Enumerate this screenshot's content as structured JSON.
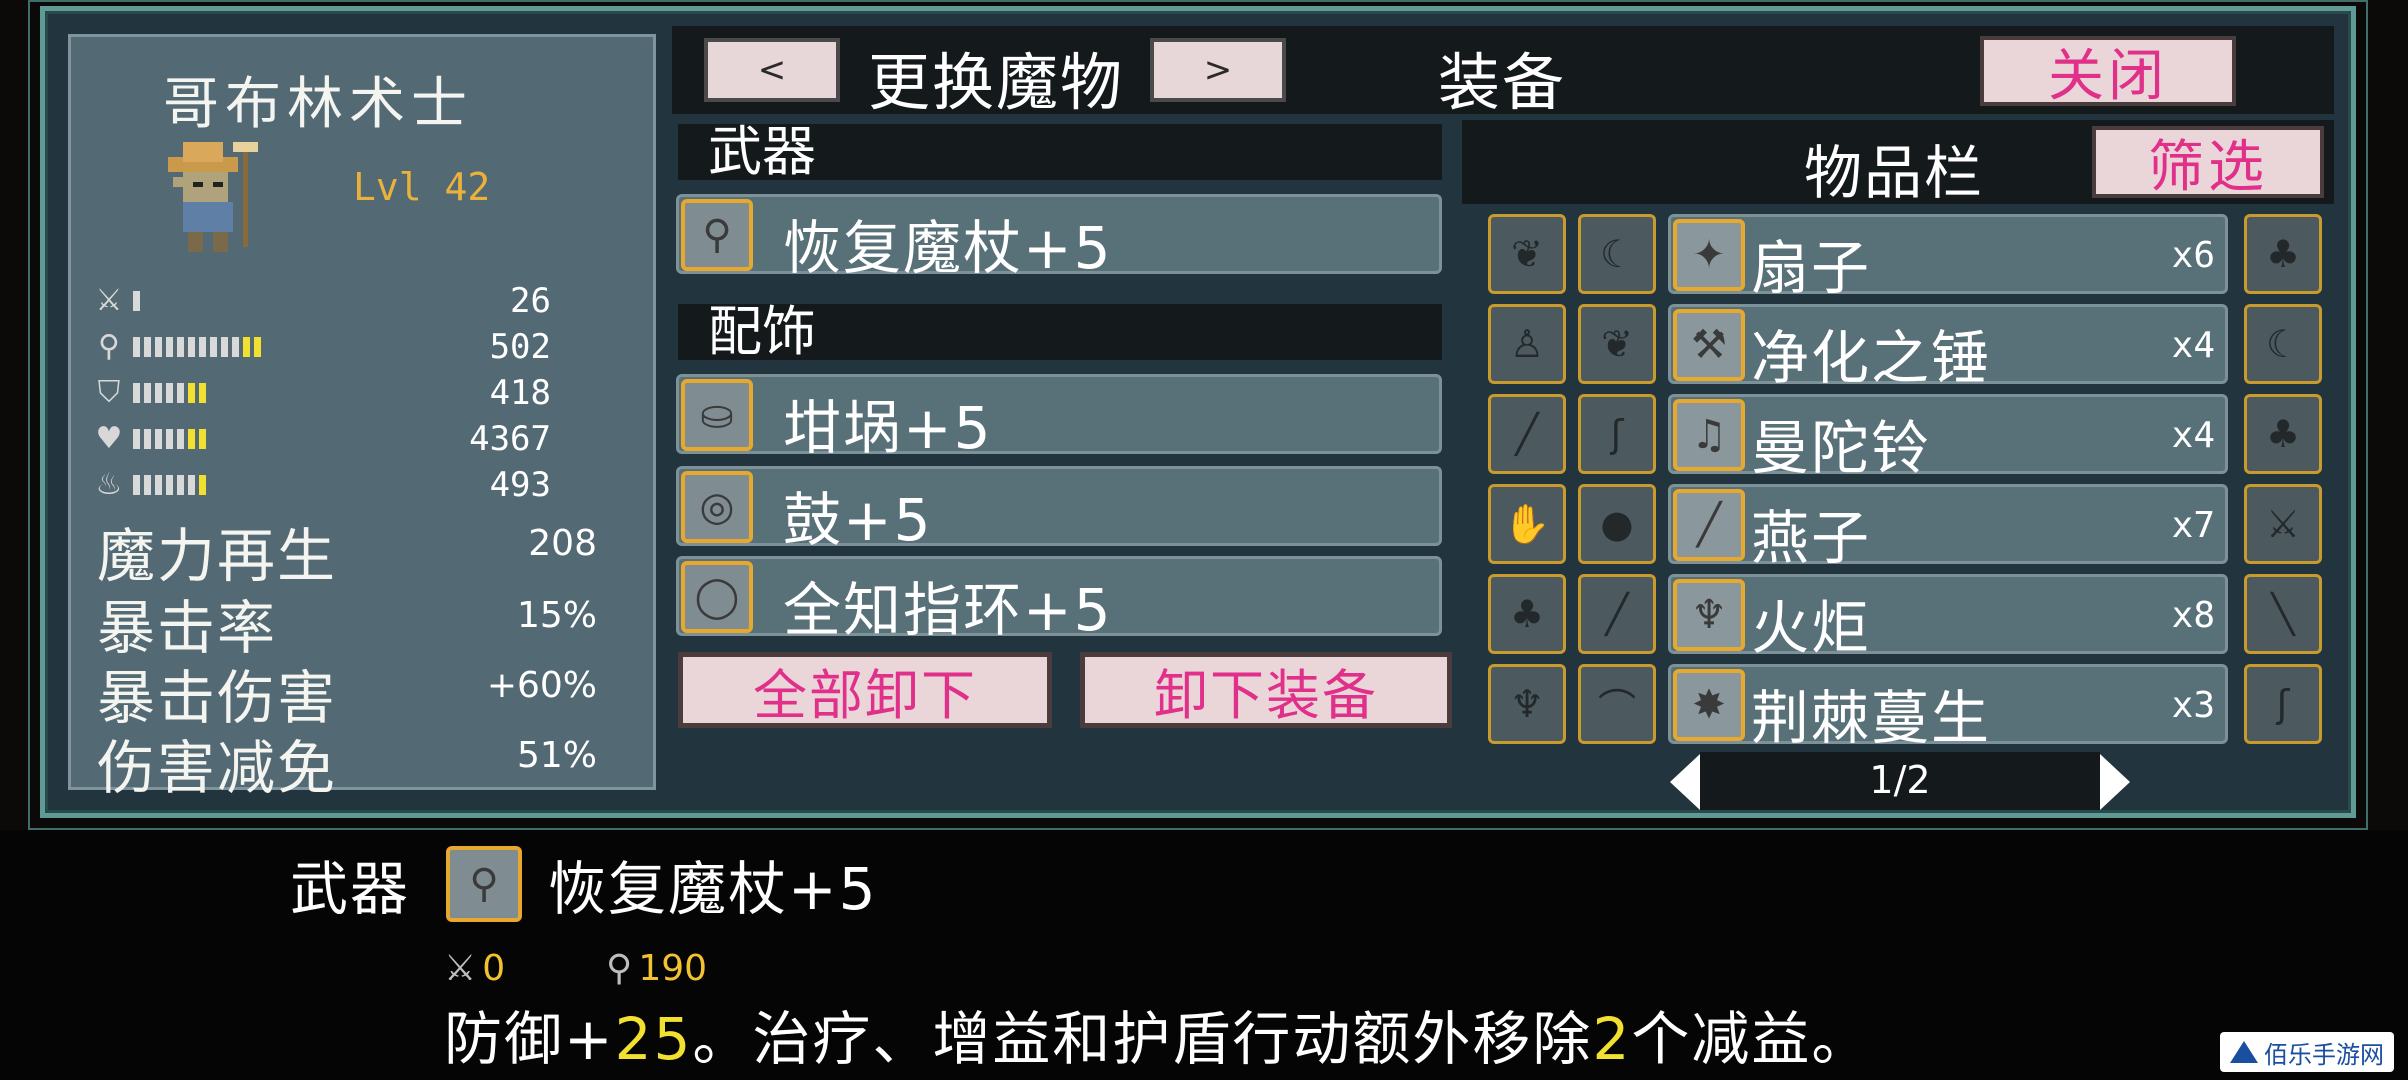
{
  "monster": {
    "name": "哥布林术士",
    "level": "Lvl 42",
    "stats": [
      {
        "icon": "sword-icon",
        "value": "26",
        "white": 1,
        "yellow": 0
      },
      {
        "icon": "staff-icon",
        "value": "502",
        "white": 10,
        "yellow": 2
      },
      {
        "icon": "shield-icon",
        "value": "418",
        "white": 5,
        "yellow": 2
      },
      {
        "icon": "heart-icon",
        "value": "4367",
        "white": 5,
        "yellow": 2
      },
      {
        "icon": "potion-icon",
        "value": "493",
        "white": 6,
        "yellow": 1
      }
    ],
    "labels": [
      {
        "label": "魔力再生",
        "value": "208"
      },
      {
        "label": "暴击率",
        "value": "15%"
      },
      {
        "label": "暴击伤害",
        "value": "+60%"
      },
      {
        "label": "伤害减免",
        "value": "51%"
      }
    ]
  },
  "topbar": {
    "prev": "<",
    "change_monster": "更换魔物",
    "next": ">",
    "equipment": "装备",
    "close": "关闭"
  },
  "weapon_section": {
    "title": "武器",
    "item": "恢复魔杖+5"
  },
  "accessory_section": {
    "title": "配饰",
    "items": [
      "坩埚+5",
      "鼓+5",
      "全知指环+5"
    ]
  },
  "actions": {
    "unequip_all": "全部卸下",
    "unequip": "卸下装备"
  },
  "inventory": {
    "title": "物品栏",
    "filter": "筛选",
    "rows": [
      {
        "name": "扇子",
        "count": "x6"
      },
      {
        "name": "净化之锤",
        "count": "x4"
      },
      {
        "name": "曼陀铃",
        "count": "x4"
      },
      {
        "name": "燕子",
        "count": "x7"
      },
      {
        "name": "火炬",
        "count": "x8"
      },
      {
        "name": "荆棘蔓生",
        "count": "x3"
      }
    ],
    "page": "1/2"
  },
  "details": {
    "category": "武器",
    "name": "恢复魔杖+5",
    "stat1": "0",
    "stat2": "190",
    "desc_part1": "防御+",
    "desc_num1": "25",
    "desc_part2": "。治疗、增益和护盾行动额外移除",
    "desc_num2": "2",
    "desc_part3": "个减益。"
  },
  "watermark": "佰乐手游网"
}
